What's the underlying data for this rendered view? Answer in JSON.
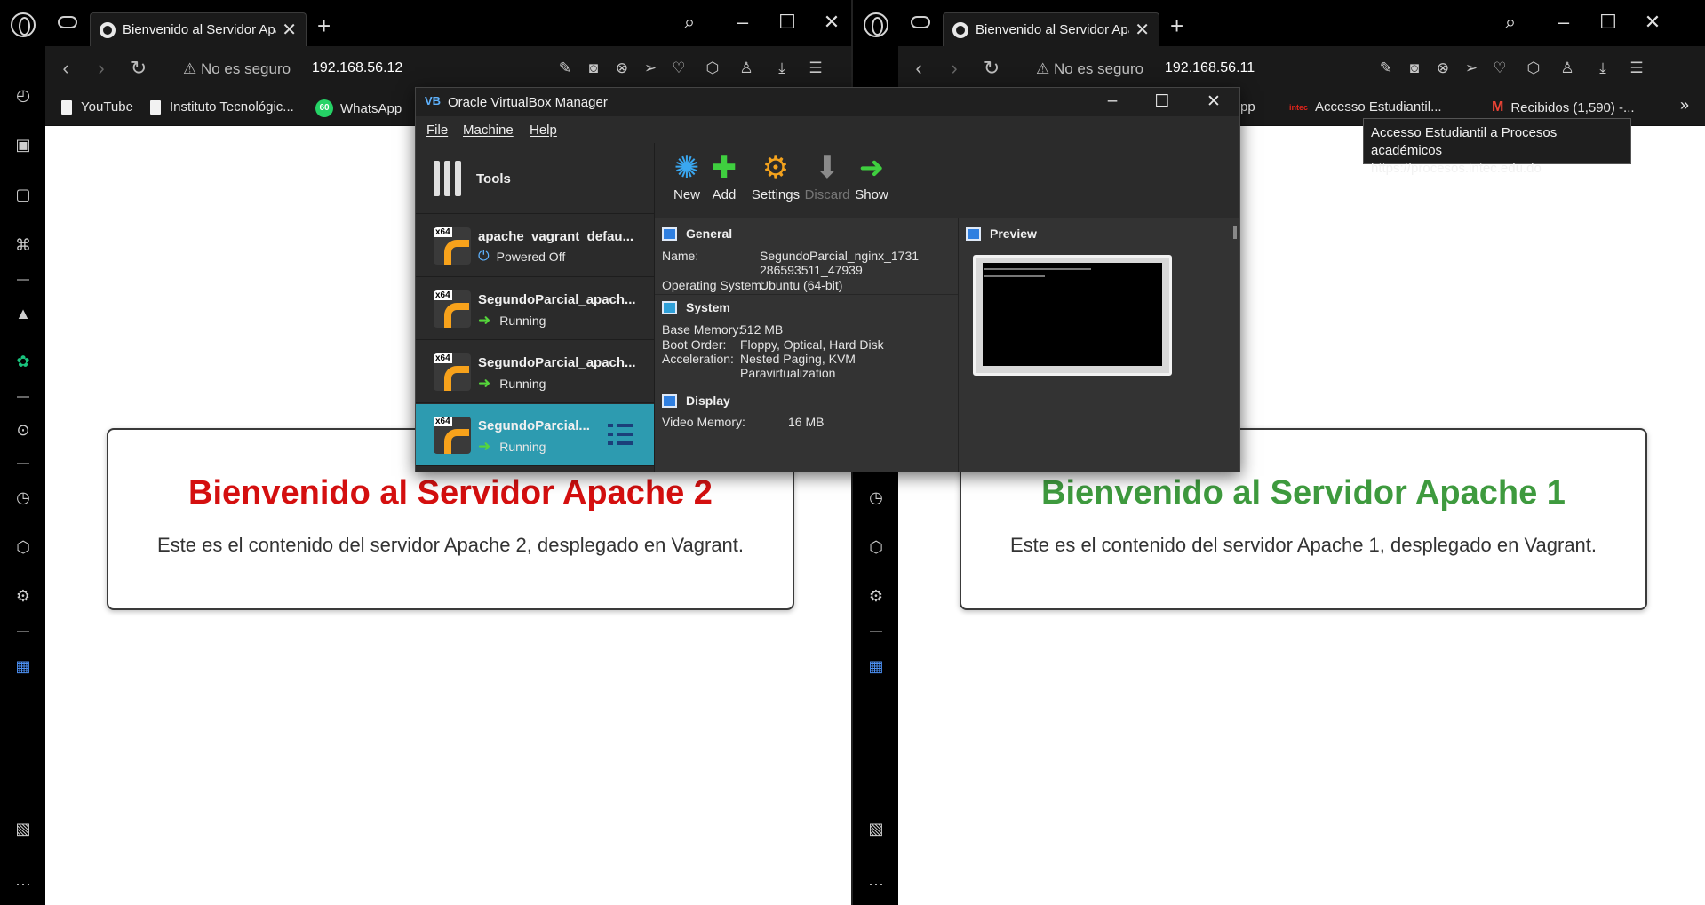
{
  "left_browser": {
    "tab_title": "Bienvenido al Servidor Apache 2",
    "security_label": "No es seguro",
    "url": "192.168.56.12",
    "bookmarks": [
      {
        "label": "YouTube"
      },
      {
        "label": "Instituto Tecnológic..."
      },
      {
        "label": "WhatsApp",
        "badge": "60"
      }
    ],
    "heading": "Bienvenido al Servidor Apache 2",
    "paragraph": "Este es el contenido del servidor Apache 2, desplegado en Vagrant."
  },
  "right_browser": {
    "tab_title": "Bienvenido al Servidor Apache 1",
    "security_label": "No es seguro",
    "url": "192.168.56.11",
    "bookmarks": [
      {
        "label": "pp"
      },
      {
        "label": "Accesso Estudiantil...",
        "badge": "intec"
      },
      {
        "label": "Recibidos (1,590) -..."
      }
    ],
    "heading": "Bienvenido al Servidor Apache 1",
    "paragraph": "Este es el contenido del servidor Apache 1, desplegado en Vagrant."
  },
  "tooltip": {
    "line1": "Accesso Estudiantil a Procesos académicos",
    "line2": "https://procesos.intec.edu.do"
  },
  "colors": {
    "heading_red": "#d40f0f",
    "heading_green": "#3e9a3e",
    "selection": "#2d9bb0"
  },
  "vbox": {
    "title": "Oracle VirtualBox Manager",
    "menu": [
      "File",
      "Machine",
      "Help"
    ],
    "tools_label": "Tools",
    "toolbar": [
      {
        "label": "New",
        "icon": "new-icon"
      },
      {
        "label": "Add",
        "icon": "add-icon"
      },
      {
        "label": "Settings",
        "icon": "settings-icon"
      },
      {
        "label": "Discard",
        "icon": "discard-icon"
      },
      {
        "label": "Show",
        "icon": "show-icon"
      }
    ],
    "vms": [
      {
        "name": "apache_vagrant_defau...",
        "state": "Powered Off",
        "badge": "x64"
      },
      {
        "name": "SegundoParcial_apach...",
        "state": "Running",
        "badge": "x64"
      },
      {
        "name": "SegundoParcial_apach...",
        "state": "Running",
        "badge": "x64"
      },
      {
        "name": "SegundoParcial...",
        "state": "Running",
        "badge": "x64"
      }
    ],
    "general": {
      "title": "General",
      "name_label": "Name:",
      "name_value_1": "SegundoParcial_nginx_1731",
      "name_value_2": "286593511_47939",
      "os_label": "Operating System:",
      "os_value": "Ubuntu (64-bit)"
    },
    "system": {
      "title": "System",
      "memory_label": "Base Memory:",
      "memory_value": "512 MB",
      "boot_label": "Boot Order:",
      "boot_value": "Floppy, Optical, Hard Disk",
      "accel_label": "Acceleration:",
      "accel_value_1": "Nested Paging, KVM",
      "accel_value_2": "Paravirtualization"
    },
    "display": {
      "title": "Display",
      "video_label": "Video Memory:",
      "video_value": "16 MB"
    },
    "preview_title": "Preview"
  }
}
